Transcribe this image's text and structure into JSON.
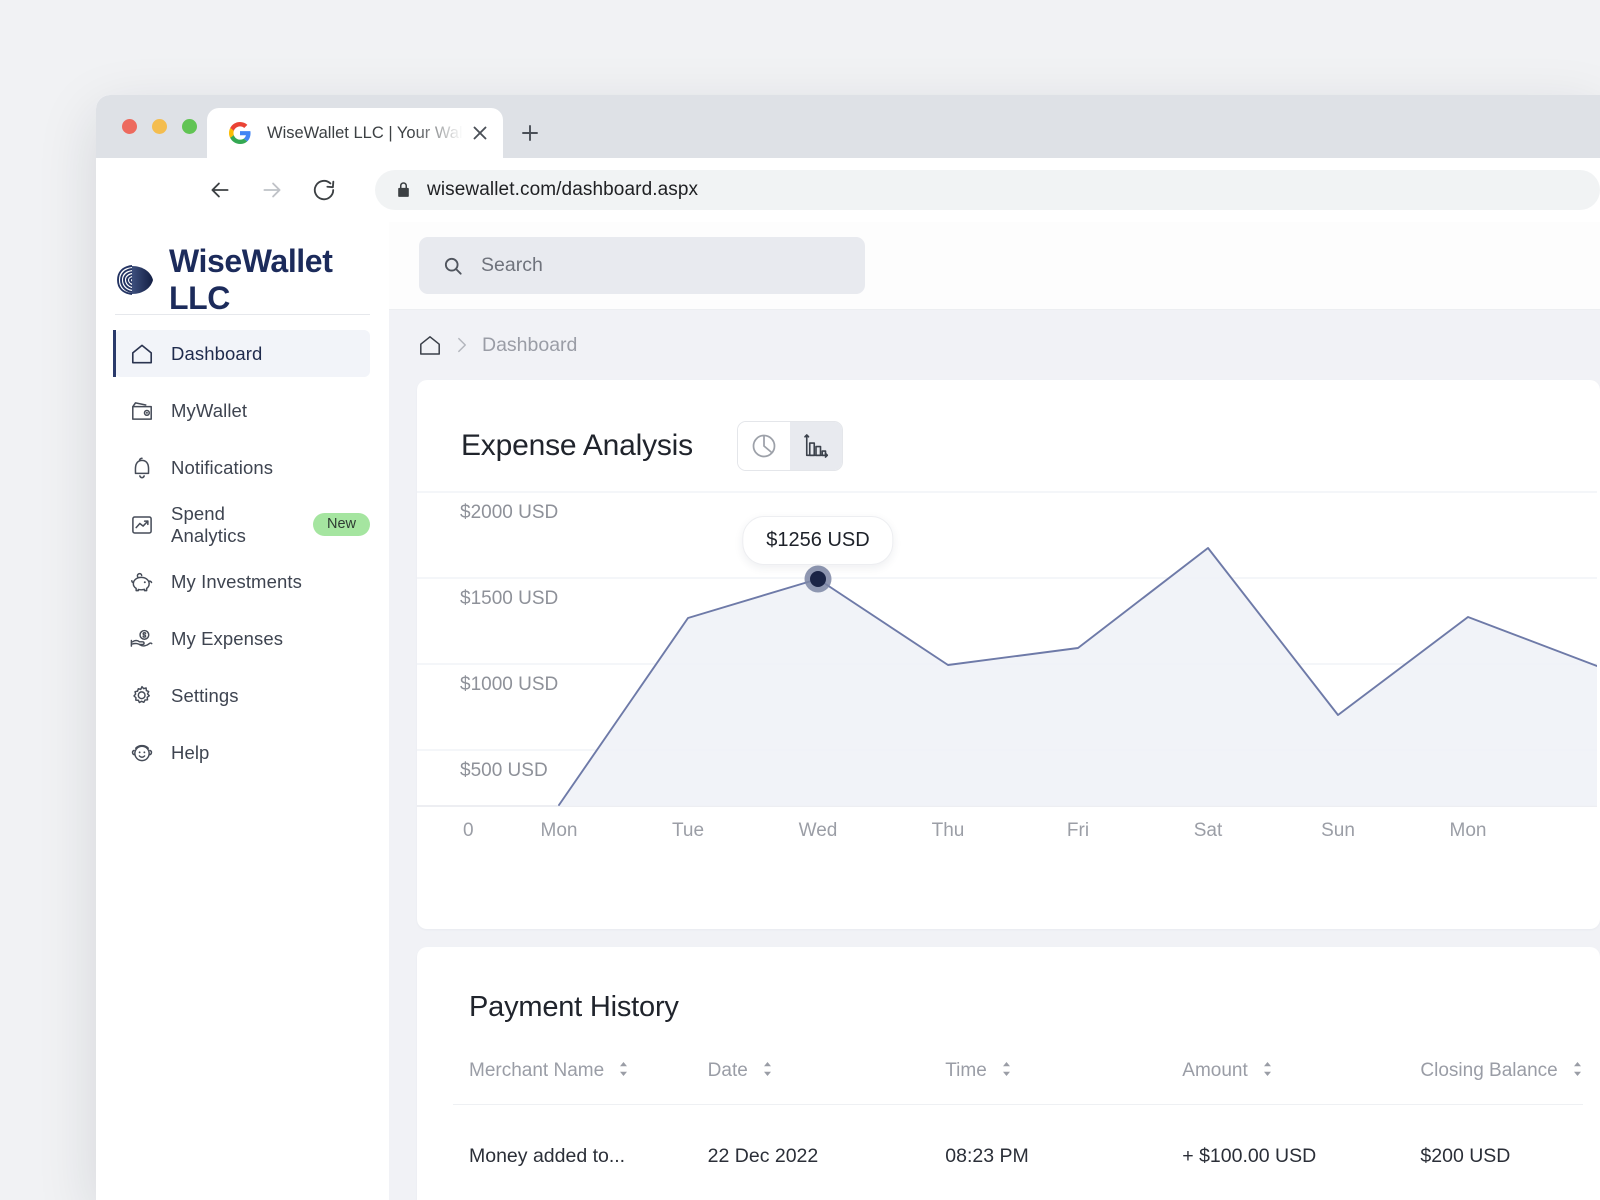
{
  "browser": {
    "tab_title": "WiseWallet LLC | Your Wallet is",
    "url": "wisewallet.com/dashboard.aspx",
    "new_tab_label": "+"
  },
  "sidebar": {
    "brand_name": "WiseWallet LLC",
    "items": [
      {
        "label": "Dashboard",
        "icon": "home-icon",
        "active": true,
        "badge": null
      },
      {
        "label": "MyWallet",
        "icon": "wallet-icon",
        "active": false,
        "badge": null
      },
      {
        "label": "Notifications",
        "icon": "bell-icon",
        "active": false,
        "badge": null
      },
      {
        "label": "Spend Analytics",
        "icon": "chart-square-icon",
        "active": false,
        "badge": "New"
      },
      {
        "label": "My Investments",
        "icon": "piggy-bank-icon",
        "active": false,
        "badge": null
      },
      {
        "label": "My Expenses",
        "icon": "hand-coin-icon",
        "active": false,
        "badge": null
      },
      {
        "label": "Settings",
        "icon": "gear-icon",
        "active": false,
        "badge": null
      },
      {
        "label": "Help",
        "icon": "support-face-icon",
        "active": false,
        "badge": null
      }
    ]
  },
  "search": {
    "placeholder": "Search"
  },
  "breadcrumb": {
    "home": "home-icon",
    "current": "Dashboard"
  },
  "expense_card": {
    "title": "Expense Analysis",
    "toggle": [
      {
        "icon": "pie-chart-icon",
        "selected": false
      },
      {
        "icon": "bar-chart-icon",
        "selected": true
      }
    ],
    "tooltip": "$1256 USD"
  },
  "chart_data": {
    "type": "area",
    "title": "Expense Analysis",
    "xlabel": "",
    "ylabel": "",
    "x_axis_origin_label": "0",
    "categories": [
      "Mon",
      "Tue",
      "Wed",
      "Thu",
      "Fri",
      "Sat",
      "Sun",
      "Mon"
    ],
    "ytick_labels": [
      "$2000 USD",
      "$1500 USD",
      "$1000 USD",
      "$500 USD"
    ],
    "ytick_values": [
      2000,
      1500,
      1000,
      500
    ],
    "ylim": [
      0,
      2250
    ],
    "grid": true,
    "legend": "none",
    "series": [
      {
        "name": "Expense",
        "values": [
          180,
          1090,
          1256,
          870,
          960,
          1460,
          490,
          1100
        ],
        "line_color": "#6e7aa8",
        "fill_color": "#eef0f6"
      }
    ],
    "annotations": [
      {
        "category": "Wed",
        "value": 1256,
        "label": "$1256 USD",
        "marker": true
      }
    ]
  },
  "payment_history": {
    "title": "Payment History",
    "columns": [
      {
        "label": "Merchant Name",
        "sortable": true
      },
      {
        "label": "Date",
        "sortable": true
      },
      {
        "label": "Time",
        "sortable": true
      },
      {
        "label": "Amount",
        "sortable": true
      },
      {
        "label": "Closing Balance",
        "sortable": true
      }
    ],
    "rows": [
      {
        "merchant": "Money added to...",
        "date": "22 Dec 2022",
        "time": "08:23 PM",
        "amount": "+ $100.00 USD",
        "amount_positive": true,
        "closing_balance": "$200 USD"
      }
    ]
  },
  "colors": {
    "brand_navy": "#1c2b5b",
    "badge_green": "#a5e5a0",
    "amount_green": "#2e9c3f",
    "chart_line": "#6e7aa8",
    "marker_fill": "#1b2546"
  }
}
